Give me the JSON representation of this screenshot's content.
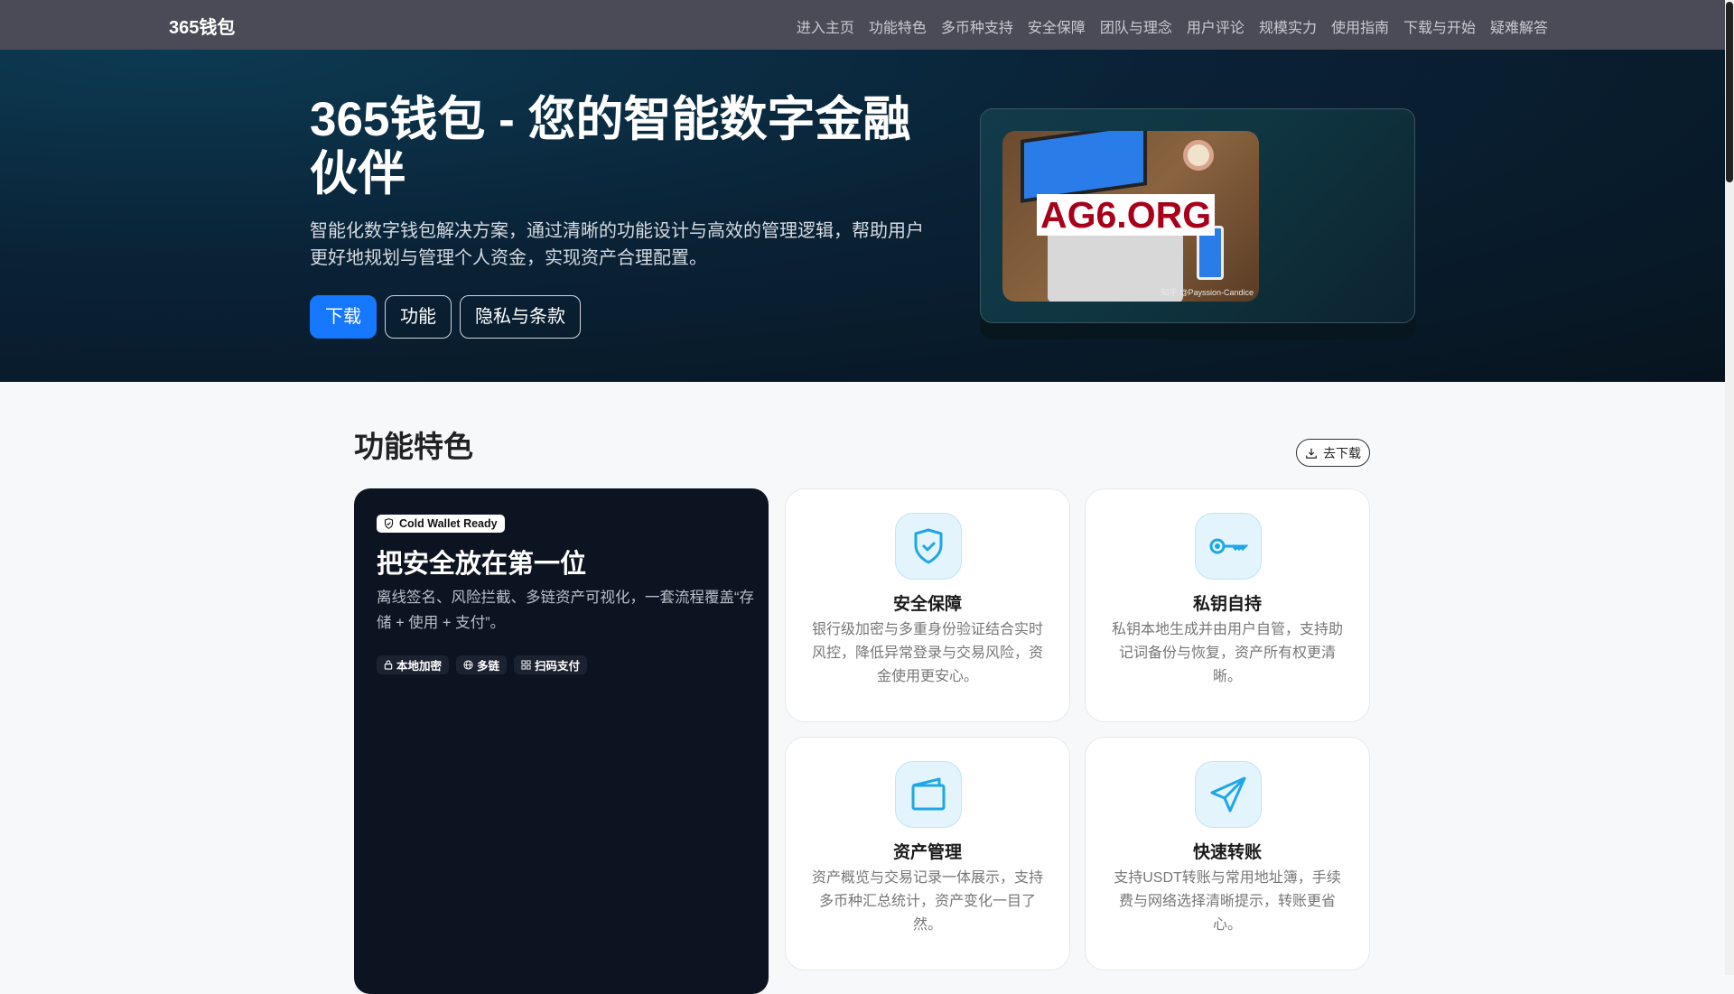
{
  "nav": {
    "logo": "365钱包",
    "links": [
      "进入主页",
      "功能特色",
      "多币种支持",
      "安全保障",
      "团队与理念",
      "用户评论",
      "规模实力",
      "使用指南",
      "下载与开始",
      "疑难解答"
    ]
  },
  "hero": {
    "title": "365钱包 - 您的智能数字金融伙伴",
    "subtitle": "智能化数字钱包解决方案，通过清晰的功能设计与高效的管理逻辑，帮助用户更好地规划与管理个人资金，实现资产合理配置。",
    "buttons": [
      "下载",
      "功能",
      "隐私与条款"
    ],
    "image": {
      "watermark": "AG6.ORG",
      "credit": "知乎 @Payssion-Candice"
    }
  },
  "features": {
    "title": "功能特色",
    "download_label": "去下载",
    "highlight": {
      "badge": "Cold Wallet Ready",
      "title": "把安全放在第一位",
      "desc": "离线签名、风险拦截、多链资产可视化，一套流程覆盖“存储 + 使用 + 支付”。",
      "chips": [
        "本地加密",
        "多链",
        "扫码支付"
      ]
    },
    "cards": [
      {
        "title": "安全保障",
        "desc": "银行级加密与多重身份验证结合实时风控，降低异常登录与交易风险，资金使用更安心。"
      },
      {
        "title": "私钥自持",
        "desc": "私钥本地生成并由用户自管，支持助记词备份与恢复，资产所有权更清晰。"
      },
      {
        "title": "资产管理",
        "desc": "资产概览与交易记录一体展示，支持多币种汇总统计，资产变化一目了然。"
      },
      {
        "title": "快速转账",
        "desc": "支持USDT转账与常用地址簿，手续费与网络选择清晰提示，转账更省心。"
      }
    ]
  },
  "colors": {
    "primary": "#1677ff",
    "icon": "#1ea7e8",
    "nav": "#4a4b57"
  }
}
